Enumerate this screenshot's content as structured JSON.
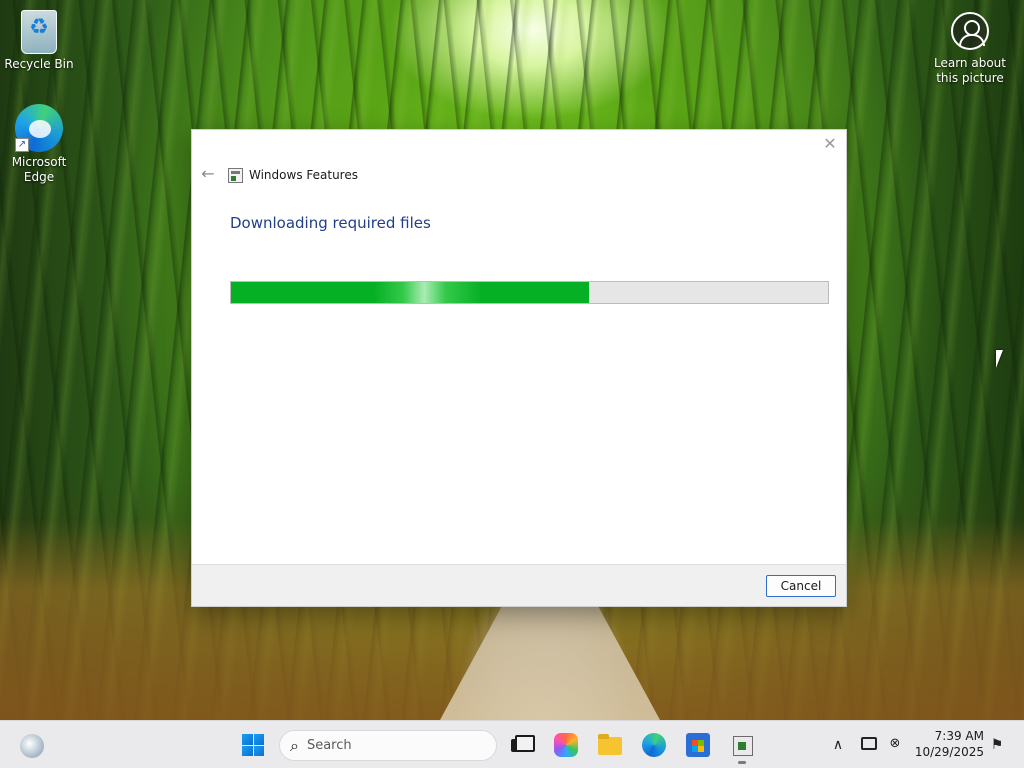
{
  "desktop": {
    "icons": [
      {
        "label": "Recycle Bin",
        "icon": "recycle-bin-icon"
      },
      {
        "label": "Microsoft\nEdge",
        "icon": "edge-icon"
      }
    ],
    "learn_about": {
      "label": "Learn about\nthis picture",
      "icon": "camera-info-icon"
    }
  },
  "dialog": {
    "title": "Windows Features",
    "heading": "Downloading required files",
    "progress_percent": 60,
    "cancel_label": "Cancel",
    "close_glyph": "✕",
    "back_glyph": "←"
  },
  "taskbar": {
    "search_placeholder": "Search",
    "search_glyph": "⌕",
    "apps": [
      "task-view",
      "copilot",
      "file-explorer",
      "microsoft-edge",
      "microsoft-store",
      "windows-features"
    ],
    "tray": {
      "chevron_glyph": "∧",
      "volume_glyph": "⊗",
      "notification_glyph": "⚑",
      "time": "7:39 AM",
      "date": "10/29/2025"
    }
  },
  "colors": {
    "progress": "#06b025",
    "heading": "#1f3f8a",
    "accent_border": "#2f6fcf"
  }
}
